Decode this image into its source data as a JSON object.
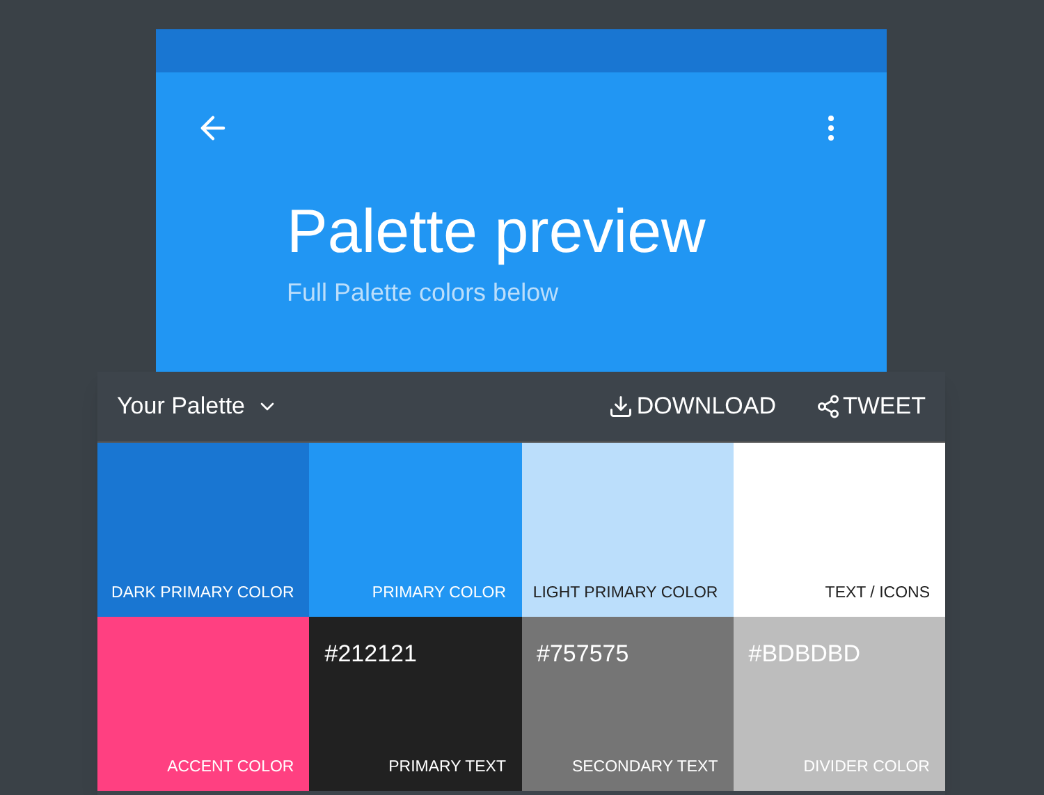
{
  "preview": {
    "title": "Palette preview",
    "subtitle": "Full Palette colors below"
  },
  "palette": {
    "name": "Your Palette",
    "actions": [
      {
        "kind": "download",
        "label": "DOWNLOAD"
      },
      {
        "kind": "share",
        "label": "TWEET"
      }
    ],
    "swatches": [
      {
        "kind": "light",
        "color": "#1976d2",
        "label": "DARK PRIMARY COLOR"
      },
      {
        "kind": "light",
        "color": "#2196f3",
        "label": "PRIMARY COLOR"
      },
      {
        "kind": "dark",
        "color": "#bbdefb",
        "label": "LIGHT PRIMARY COLOR"
      },
      {
        "kind": "dark",
        "color": "#ffffff",
        "label": "TEXT / ICONS"
      },
      {
        "kind": "light",
        "color": "#ff4081",
        "label": "ACCENT COLOR"
      },
      {
        "kind": "light",
        "color": "#212121",
        "hex_code": "#212121",
        "label": "PRIMARY TEXT"
      },
      {
        "kind": "light",
        "color": "#757575",
        "hex_code": "#757575",
        "label": "SECONDARY TEXT"
      },
      {
        "kind": "light",
        "color": "#bdbdbd",
        "hex_code": "#BDBDBD",
        "label": "DIVIDER COLOR"
      }
    ]
  }
}
